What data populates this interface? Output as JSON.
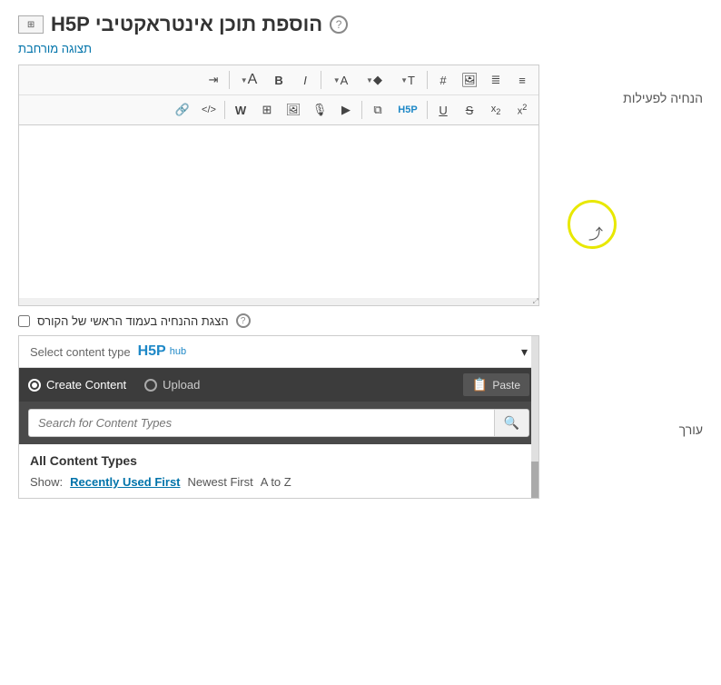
{
  "page": {
    "title": "הוספת תוכן אינטראקטיבי H5P",
    "help_icon": "?",
    "icon_box": "⊞"
  },
  "labels": {
    "expanded": "תצוגה מורחבת",
    "actions": "הנחיה לפעילות",
    "editor": "עורך"
  },
  "toolbar": {
    "row1": [
      {
        "id": "ordered-list",
        "icon": "≡",
        "title": "Ordered List"
      },
      {
        "id": "unordered-list",
        "icon": "≣",
        "title": "Unordered List"
      },
      {
        "id": "image-upload",
        "icon": "🖼",
        "title": "Upload Image"
      },
      {
        "id": "hash",
        "icon": "#",
        "title": "Heading"
      },
      {
        "id": "text-format",
        "icon": "T",
        "title": "Text Format",
        "dropdown": true
      },
      {
        "id": "lightbulb",
        "icon": "💡",
        "title": "Hint",
        "dropdown": true
      },
      {
        "id": "color",
        "icon": "A",
        "title": "Color",
        "dropdown": true
      },
      {
        "id": "italic",
        "icon": "I",
        "title": "Italic"
      },
      {
        "id": "bold",
        "icon": "B",
        "title": "Bold"
      },
      {
        "id": "font-size",
        "icon": "A",
        "title": "Font Size",
        "dropdown": true
      },
      {
        "id": "indent",
        "icon": "⇥",
        "title": "Indent"
      }
    ],
    "row2": [
      {
        "id": "superscript",
        "icon": "x²",
        "title": "Superscript"
      },
      {
        "id": "subscript",
        "icon": "x₂",
        "title": "Subscript"
      },
      {
        "id": "strikethrough",
        "icon": "S̶",
        "title": "Strikethrough"
      },
      {
        "id": "underline",
        "icon": "U",
        "title": "Underline"
      },
      {
        "id": "h5p-embed",
        "icon": "H5P",
        "title": "H5P"
      },
      {
        "id": "copy-format",
        "icon": "⧉",
        "title": "Copy Format"
      },
      {
        "id": "video",
        "icon": "▶",
        "title": "Video"
      },
      {
        "id": "audio",
        "icon": "🎙",
        "title": "Audio"
      },
      {
        "id": "image",
        "icon": "🖼",
        "title": "Image"
      },
      {
        "id": "gallery",
        "icon": "⊞",
        "title": "Gallery"
      },
      {
        "id": "doc",
        "icon": "W",
        "title": "Document"
      },
      {
        "id": "code",
        "icon": "</>",
        "title": "Code"
      },
      {
        "id": "link",
        "icon": "🔗",
        "title": "Link"
      }
    ]
  },
  "checkbox": {
    "label": "הצגת ההנחיה בעמוד הראשי של הקורס"
  },
  "h5p": {
    "logo_text": "H5P",
    "logo_hub": "hub",
    "select_placeholder": "Select content type",
    "dropdown_arrow": "▾",
    "tabs": {
      "create": "Create Content",
      "upload": "Upload"
    },
    "paste_button": "Paste",
    "search_placeholder": "Search for Content Types",
    "all_types_title": "All Content Types",
    "show_label": "Show:",
    "sort_options": [
      {
        "id": "recently-used",
        "label": "Recently Used First",
        "active": true
      },
      {
        "id": "newest-first",
        "label": "Newest First",
        "active": false
      },
      {
        "id": "a-to-z",
        "label": "A to Z",
        "active": false
      }
    ]
  }
}
